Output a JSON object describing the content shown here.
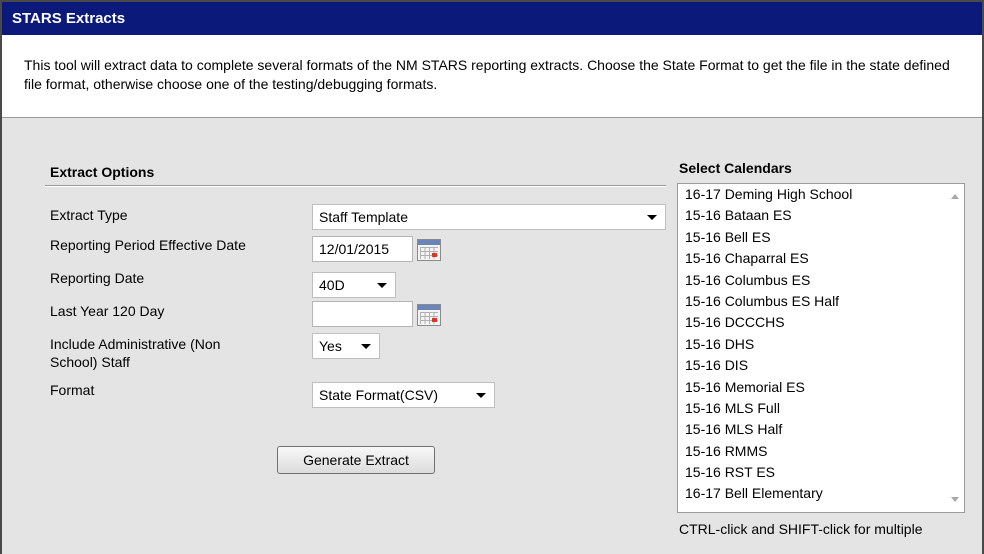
{
  "window": {
    "title": "STARS Extracts"
  },
  "description": "This tool will extract data to complete several formats of the NM STARS reporting extracts. Choose the State Format to get the file in the state defined file format, otherwise choose one of the testing/debugging formats.",
  "extract_options": {
    "title": "Extract Options",
    "extract_type": {
      "label": "Extract Type",
      "value": "Staff Template"
    },
    "reporting_period_effective_date": {
      "label": "Reporting Period Effective Date",
      "value": "12/01/2015"
    },
    "reporting_date": {
      "label": "Reporting Date",
      "value": "40D"
    },
    "last_year_120_day": {
      "label": "Last Year 120 Day",
      "value": ""
    },
    "include_admin_staff": {
      "label": "Include Administrative (Non School) Staff",
      "value": "Yes"
    },
    "format": {
      "label": "Format",
      "value": "State Format(CSV)"
    },
    "generate_button": "Generate Extract"
  },
  "calendars": {
    "title": "Select Calendars",
    "items": [
      "16-17 Deming High School",
      "15-16 Bataan ES",
      "15-16 Bell ES",
      "15-16 Chaparral ES",
      "15-16 Columbus ES",
      "15-16 Columbus ES Half",
      "15-16 DCCCHS",
      "15-16 DHS",
      "15-16 DIS",
      "15-16 Memorial ES",
      "15-16 MLS Full",
      "15-16 MLS Half",
      "15-16 RMMS",
      "15-16 RST ES",
      "16-17 Bell Elementary"
    ],
    "hint": "CTRL-click and SHIFT-click for multiple"
  },
  "colors": {
    "titlebar": "#0b1a7a",
    "panel": "#e4e4e4"
  }
}
